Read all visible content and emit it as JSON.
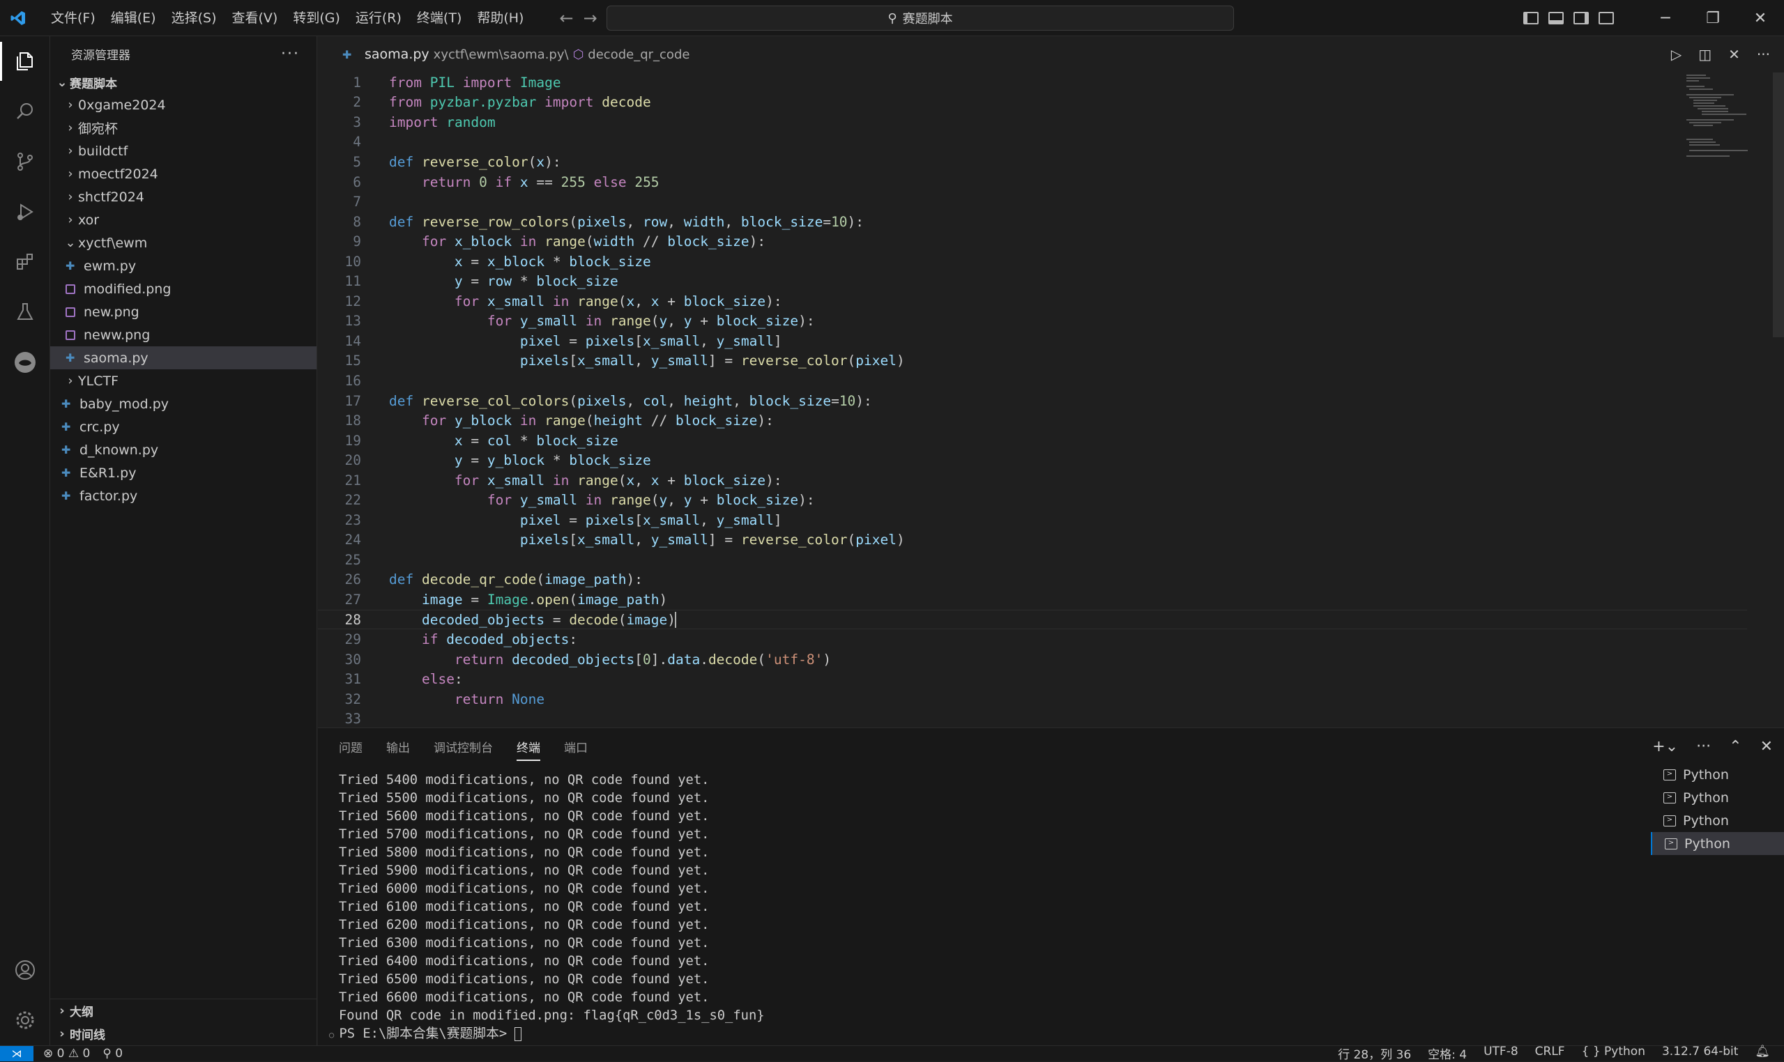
{
  "titlebar": {
    "menu": [
      "文件(F)",
      "编辑(E)",
      "选择(S)",
      "查看(V)",
      "转到(G)",
      "运行(R)",
      "终端(T)",
      "帮助(H)"
    ],
    "search": "赛题脚本"
  },
  "sidebar": {
    "header": "资源管理器",
    "root": "赛题脚本",
    "items": [
      {
        "label": "0xgame2024",
        "kind": "folder",
        "depth": 1
      },
      {
        "label": "御宛杯",
        "kind": "folder",
        "depth": 1
      },
      {
        "label": "buildctf",
        "kind": "folder",
        "depth": 1
      },
      {
        "label": "moectf2024",
        "kind": "folder",
        "depth": 1
      },
      {
        "label": "shctf2024",
        "kind": "folder",
        "depth": 1
      },
      {
        "label": "xor",
        "kind": "folder",
        "depth": 1
      },
      {
        "label": "xyctf\\ewm",
        "kind": "folder-open",
        "depth": 1
      },
      {
        "label": "ewm.py",
        "kind": "py",
        "depth": 2
      },
      {
        "label": "modified.png",
        "kind": "png",
        "depth": 2
      },
      {
        "label": "new.png",
        "kind": "png",
        "depth": 2
      },
      {
        "label": "neww.png",
        "kind": "png",
        "depth": 2
      },
      {
        "label": "saoma.py",
        "kind": "py",
        "depth": 2,
        "selected": true
      },
      {
        "label": "YLCTF",
        "kind": "folder",
        "depth": 1
      },
      {
        "label": "baby_mod.py",
        "kind": "py",
        "depth": 1
      },
      {
        "label": "crc.py",
        "kind": "py",
        "depth": 1
      },
      {
        "label": "d_known.py",
        "kind": "py",
        "depth": 1
      },
      {
        "label": "E&R1.py",
        "kind": "py",
        "depth": 1
      },
      {
        "label": "factor.py",
        "kind": "py",
        "depth": 1
      }
    ],
    "outline": "大纲",
    "timeline": "时间线"
  },
  "editor": {
    "filename": "saoma.py",
    "path": "xyctf\\ewm\\saoma.py\\",
    "symbol": "decode_qr_code",
    "current_line": 28
  },
  "panel": {
    "tabs": [
      "问题",
      "输出",
      "调试控制台",
      "终端",
      "端口"
    ],
    "active_tab": "终端",
    "terminal_lines": [
      "Tried 5400 modifications, no QR code found yet.",
      "Tried 5500 modifications, no QR code found yet.",
      "Tried 5600 modifications, no QR code found yet.",
      "Tried 5700 modifications, no QR code found yet.",
      "Tried 5800 modifications, no QR code found yet.",
      "Tried 5900 modifications, no QR code found yet.",
      "Tried 6000 modifications, no QR code found yet.",
      "Tried 6100 modifications, no QR code found yet.",
      "Tried 6200 modifications, no QR code found yet.",
      "Tried 6300 modifications, no QR code found yet.",
      "Tried 6400 modifications, no QR code found yet.",
      "Tried 6500 modifications, no QR code found yet.",
      "Tried 6600 modifications, no QR code found yet.",
      "Found QR code in modified.png: flag{qR_c0d3_1s_s0_fun}"
    ],
    "prompt": "PS E:\\脚本合集\\赛题脚本> ",
    "terminals": [
      "Python",
      "Python",
      "Python",
      "Python"
    ]
  },
  "statusbar": {
    "errors": "0",
    "warnings": "0",
    "ports": "0",
    "position": "行 28，列 36",
    "spaces": "空格: 4",
    "encoding": "UTF-8",
    "eol": "CRLF",
    "language": "Python",
    "interpreter": "3.12.7 64-bit"
  },
  "colors": {
    "accent": "#0078d4",
    "keyword": "#569cd6",
    "function": "#dcdcaa",
    "string": "#ce9178"
  }
}
